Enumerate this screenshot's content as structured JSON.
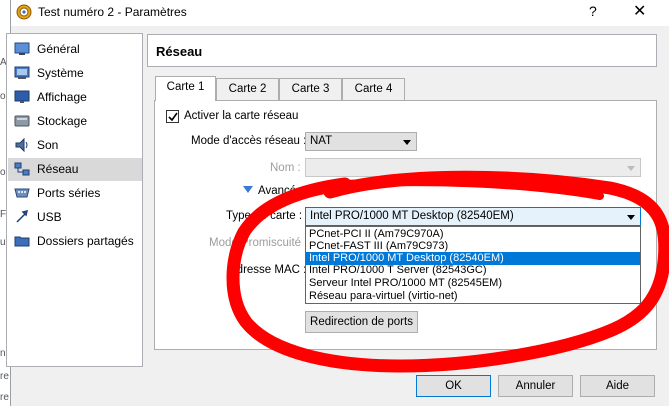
{
  "window": {
    "title": "Test numéro 2 - Paramètres",
    "help_label": "?",
    "close_label": "✕"
  },
  "background": {
    "left_text": [
      "A",
      "oc",
      "o",
      "FC",
      "ux",
      "ne",
      "re",
      "re"
    ]
  },
  "sidebar": {
    "items": [
      {
        "label": "Général",
        "icon": "general-icon",
        "selected": false
      },
      {
        "label": "Système",
        "icon": "system-icon",
        "selected": false
      },
      {
        "label": "Affichage",
        "icon": "display-icon",
        "selected": false
      },
      {
        "label": "Stockage",
        "icon": "storage-icon",
        "selected": false
      },
      {
        "label": "Son",
        "icon": "audio-icon",
        "selected": false
      },
      {
        "label": "Réseau",
        "icon": "network-icon",
        "selected": true
      },
      {
        "label": "Ports séries",
        "icon": "serial-ports-icon",
        "selected": false
      },
      {
        "label": "USB",
        "icon": "usb-icon",
        "selected": false
      },
      {
        "label": "Dossiers partagés",
        "icon": "shared-folders-icon",
        "selected": false
      }
    ]
  },
  "header": {
    "title": "Réseau"
  },
  "tabs": [
    {
      "label": "Carte 1",
      "active": true
    },
    {
      "label": "Carte 2",
      "active": false
    },
    {
      "label": "Carte 3",
      "active": false
    },
    {
      "label": "Carte 4",
      "active": false
    }
  ],
  "adapter": {
    "enable_label": "Activer la carte réseau",
    "enable_checked": true,
    "mode_label": "Mode d'accès réseau :",
    "mode_value": "NAT",
    "name_label": "Nom :",
    "name_value": "",
    "advanced_label": "Avancé",
    "type_label": "Type de carte :",
    "type_value": "Intel PRO/1000 MT Desktop (82540EM)",
    "promisc_label": "Mode Promiscuité :",
    "mac_label": "Adresse MAC :",
    "port_forward_label": "Redirection de ports",
    "type_options": [
      "PCnet-PCI II (Am79C970A)",
      "PCnet-FAST III (Am79C973)",
      "Intel PRO/1000 MT Desktop (82540EM)",
      "Intel PRO/1000 T Server (82543GC)",
      "Serveur Intel PRO/1000 MT (82545EM)",
      "Réseau para-virtuel (virtio-net)"
    ],
    "type_selected_index": 2
  },
  "footer": {
    "ok_label": "OK",
    "cancel_label": "Annuler",
    "help_label": "Aide"
  },
  "colors": {
    "accent": "#0078d7",
    "annotation": "#ff0000"
  }
}
